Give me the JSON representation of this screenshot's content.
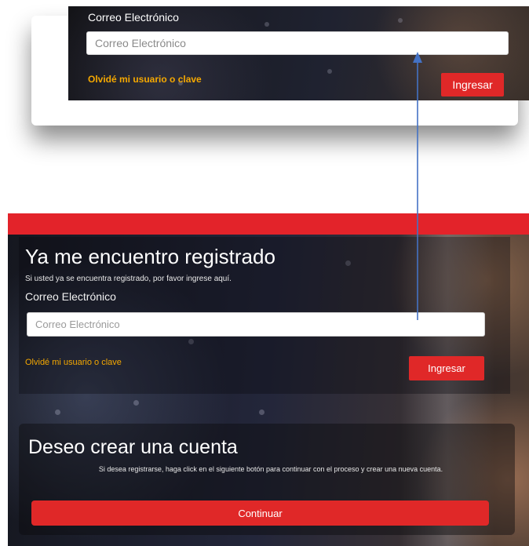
{
  "zoomed_snippet": {
    "email_label": "Correo Electrónico",
    "email_placeholder": "Correo Electrónico",
    "forgot_link": "Olvidé mi usuario o clave",
    "login_button": "Ingresar"
  },
  "login_section": {
    "title": "Ya me encuentro registrado",
    "subtitle": "Si usted ya se encuentra registrado, por favor ingrese aquí.",
    "email_label": "Correo Electrónico",
    "email_placeholder": "Correo Electrónico",
    "forgot_link": "Olvidé mi usuario o clave",
    "login_button": "Ingresar"
  },
  "create_section": {
    "title": "Deseo crear una cuenta",
    "description": "Si desea registrarse, haga click en el siguiente botón para continuar con el proceso y crear una nueva cuenta.",
    "continue_button": "Continuar"
  },
  "colors": {
    "brand_red": "#e3232a",
    "button_red": "#e02828",
    "link_orange": "#f5a800",
    "arrow_blue": "#4472c4"
  }
}
